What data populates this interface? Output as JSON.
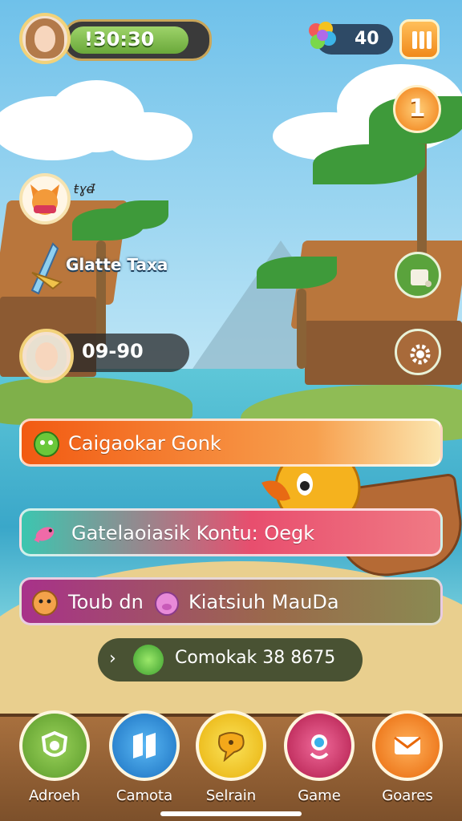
{
  "hud": {
    "player_avatar": "player-avatar",
    "timer": "!30:30",
    "gem_icon": "rainbow-gem-icon",
    "gems": "40",
    "pause_icon": "pause-icon",
    "level": "1"
  },
  "side_buttons": [
    {
      "name": "scroll-icon",
      "color": "#5aa33c"
    },
    {
      "name": "gear-icon",
      "color": "#a86a3a"
    }
  ],
  "npc": {
    "icon": "fox-icon",
    "text": "ŧɣđ̶"
  },
  "quest": {
    "icon": "wand-icon",
    "label": "Glatte Taxa"
  },
  "info_pill": {
    "value": "09-90"
  },
  "banners": [
    {
      "name": "banner-orange",
      "icon": "green-blob-icon",
      "label": "Caigaokar Gonk",
      "gradient": "linear-gradient(90deg,#f25a12,#f7a04e 70%,#fbe6b0)"
    },
    {
      "name": "banner-red",
      "icon": "fish-icon",
      "label": "Gatelaoiasik Kontu: Oegk",
      "gradient": "linear-gradient(90deg,#3cc6b0,#e84e6e 55%,#f07a84)"
    },
    {
      "name": "banner-purple",
      "icon": "face-icon",
      "label": "Toub dn",
      "icon2": "pig-icon",
      "label2": "Kiatsiuh MauDa",
      "gradient": "linear-gradient(90deg,#a8318a,#9a6a4a 60%,#8a8a52)"
    }
  ],
  "combo": {
    "arrow": "›",
    "icon": "green-blob-icon",
    "label": "Comokak 38 8675"
  },
  "nav": [
    {
      "name": "nav-adroeh",
      "icon": "shield-icon",
      "label": "Adroeh",
      "color": "#6faa38"
    },
    {
      "name": "nav-camota",
      "icon": "map-icon",
      "label": "Camota",
      "color": "#2a8fd8"
    },
    {
      "name": "nav-selrain",
      "icon": "chat-icon",
      "label": "Selrain",
      "color": "#f3cf1c"
    },
    {
      "name": "nav-game",
      "icon": "pin-icon",
      "label": "Game",
      "color": "#d8356a"
    },
    {
      "name": "nav-goares",
      "icon": "mail-icon",
      "label": "Goares",
      "color": "#f0801e"
    }
  ]
}
